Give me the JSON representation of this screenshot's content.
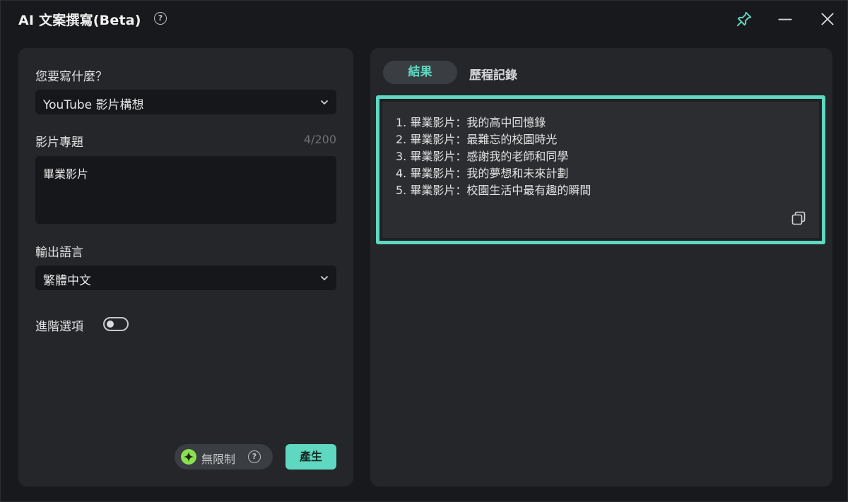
{
  "window": {
    "title": "AI 文案撰寫(Beta)",
    "help_glyph": "?"
  },
  "form": {
    "what_label": "您要寫什麼？",
    "what_value": "YouTube 影片構想",
    "topic_label": "影片專題",
    "topic_counter": "4/200",
    "topic_value": "畢業影片",
    "language_label": "輸出語言",
    "language_value": "繁體中文",
    "advanced_label": "進階選項",
    "advanced_enabled": false,
    "unlimited_label": "無限制",
    "generate_label": "產生"
  },
  "tabs": {
    "result_label": "結果",
    "history_label": "歷程記錄"
  },
  "results": [
    "1. 畢業影片：我的高中回憶錄",
    "2. 畢業影片：最難忘的校園時光",
    "3. 畢業影片：感謝我的老師和同學",
    "4. 畢業影片：我的夢想和未來計劃",
    "5. 畢業影片：校園生活中最有趣的瞬間"
  ],
  "colors": {
    "accent": "#5ed8c0",
    "background": "#18191c",
    "panel": "#24262a"
  },
  "icons": {
    "pin": "pin-icon",
    "minimize": "minimize-icon",
    "close": "close-icon",
    "copy": "copy-icon",
    "spark": "spark-icon"
  }
}
